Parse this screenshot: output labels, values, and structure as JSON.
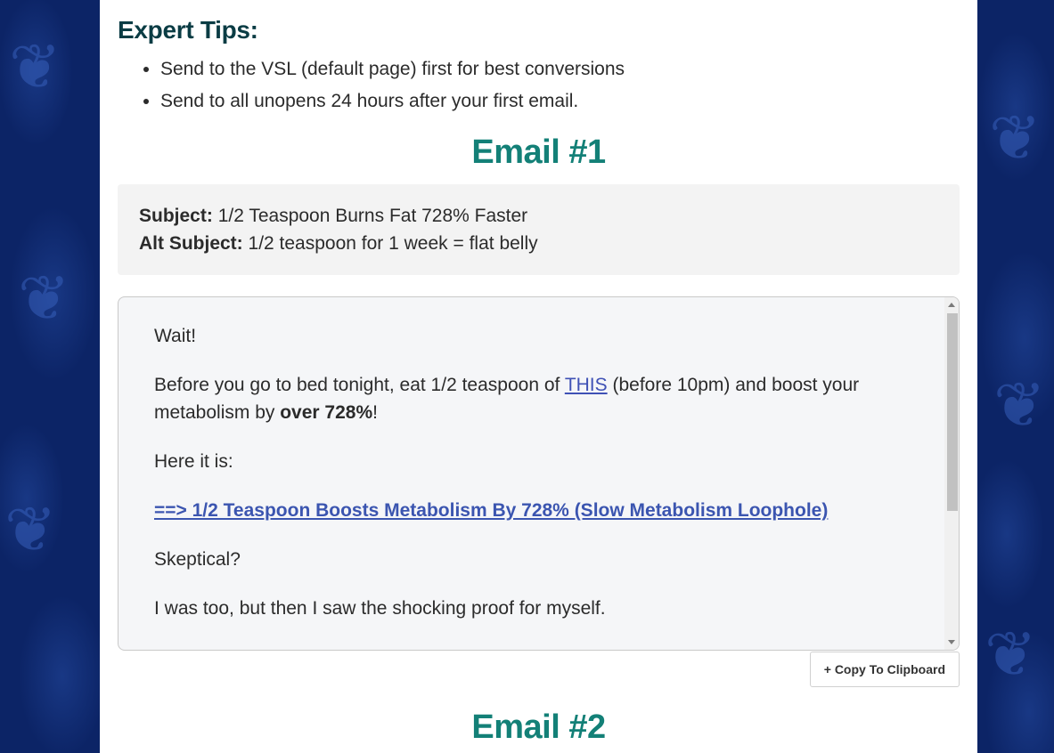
{
  "tips": {
    "heading": "Expert Tips:",
    "items": [
      "Send to the VSL (default page) first for best conversions",
      "Send to all unopens 24 hours after your first email."
    ]
  },
  "email1": {
    "heading": "Email #1",
    "subject_label": "Subject:",
    "subject": "1/2 Teaspoon Burns Fat 728% Faster",
    "alt_subject_label": "Alt Subject:",
    "alt_subject": "1/2 teaspoon for 1 week = flat belly",
    "body": {
      "p1": "Wait!",
      "p2_before": "Before you go to bed tonight, eat 1/2 teaspoon of ",
      "p2_link": "THIS",
      "p2_middle": " (before 10pm) and boost your metabolism by ",
      "p2_bold": "over 728%",
      "p2_after": "!",
      "p3": "Here it is:",
      "p4_link": "==> 1/2 Teaspoon Boosts Metabolism By 728% (Slow Metabolism Loophole)",
      "p5": "Skeptical?",
      "p6": "I was too, but then I saw the shocking proof for myself."
    },
    "copy_button": "+ Copy To Clipboard"
  },
  "email2": {
    "heading": "Email #2"
  }
}
